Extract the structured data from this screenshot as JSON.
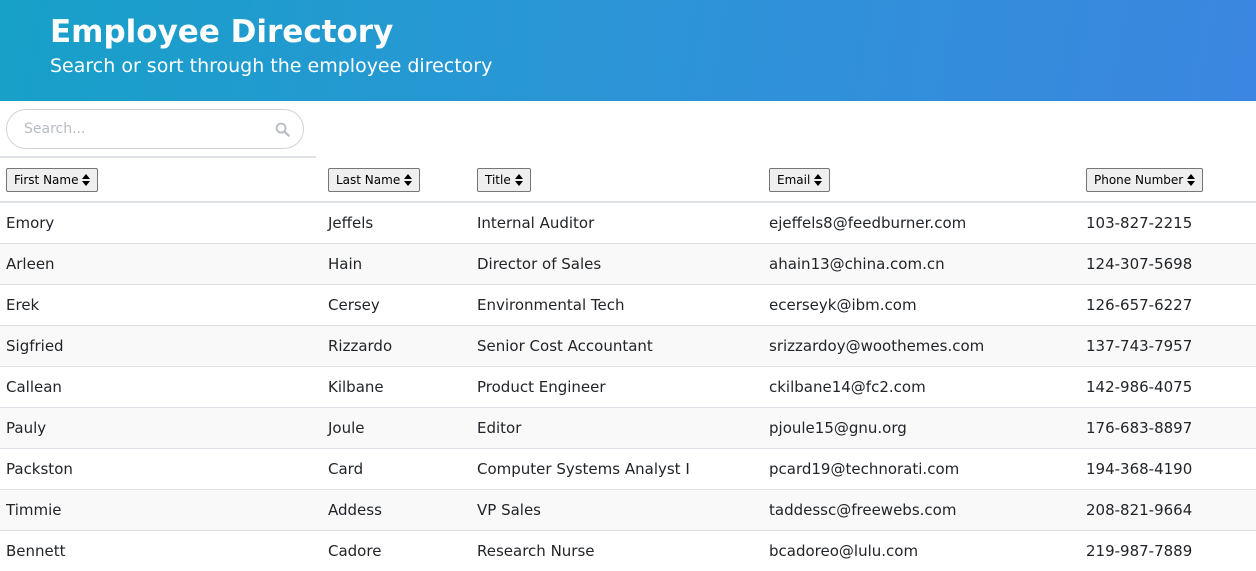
{
  "header": {
    "title": "Employee Directory",
    "subtitle": "Search or sort through the employee directory"
  },
  "search": {
    "placeholder": "Search...",
    "value": "",
    "icon": "search-icon"
  },
  "colors": {
    "header_gradient_start": "#17a0c8",
    "header_gradient_end": "#3b86e0",
    "row_stripe": "#f9f9f9",
    "border": "#dee2e6"
  },
  "table": {
    "columns": [
      {
        "key": "first",
        "label": "First Name"
      },
      {
        "key": "last",
        "label": "Last Name"
      },
      {
        "key": "title",
        "label": "Title"
      },
      {
        "key": "email",
        "label": "Email"
      },
      {
        "key": "phone",
        "label": "Phone Number"
      }
    ],
    "rows": [
      {
        "first": "Emory",
        "last": "Jeffels",
        "title": "Internal Auditor",
        "email": "ejeffels8@feedburner.com",
        "phone": "103-827-2215"
      },
      {
        "first": "Arleen",
        "last": "Hain",
        "title": "Director of Sales",
        "email": "ahain13@china.com.cn",
        "phone": "124-307-5698"
      },
      {
        "first": "Erek",
        "last": "Cersey",
        "title": "Environmental Tech",
        "email": "ecerseyk@ibm.com",
        "phone": "126-657-6227"
      },
      {
        "first": "Sigfried",
        "last": "Rizzardo",
        "title": "Senior Cost Accountant",
        "email": "srizzardoy@woothemes.com",
        "phone": "137-743-7957"
      },
      {
        "first": "Callean",
        "last": "Kilbane",
        "title": "Product Engineer",
        "email": "ckilbane14@fc2.com",
        "phone": "142-986-4075"
      },
      {
        "first": "Pauly",
        "last": "Joule",
        "title": "Editor",
        "email": "pjoule15@gnu.org",
        "phone": "176-683-8897"
      },
      {
        "first": "Packston",
        "last": "Card",
        "title": "Computer Systems Analyst I",
        "email": "pcard19@technorati.com",
        "phone": "194-368-4190"
      },
      {
        "first": "Timmie",
        "last": "Addess",
        "title": "VP Sales",
        "email": "taddessc@freewebs.com",
        "phone": "208-821-9664"
      },
      {
        "first": "Bennett",
        "last": "Cadore",
        "title": "Research Nurse",
        "email": "bcadoreo@lulu.com",
        "phone": "219-987-7889"
      }
    ]
  }
}
